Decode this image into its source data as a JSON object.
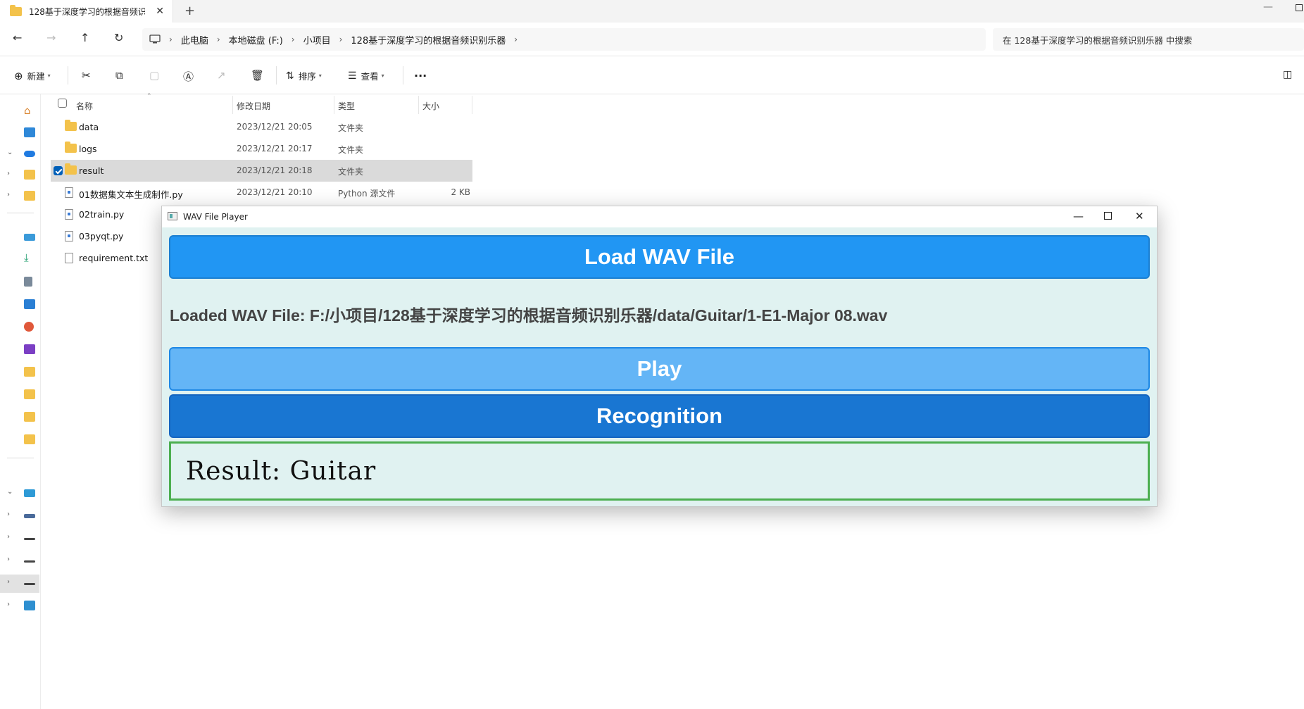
{
  "tab": {
    "title": "128基于深度学习的根据音频识别",
    "close": "✕",
    "new": "+"
  },
  "window": {
    "minimize": "—"
  },
  "address": {
    "crumbs": [
      "此电脑",
      "本地磁盘 (F:)",
      "小项目",
      "128基于深度学习的根据音频识别乐器"
    ],
    "search_placeholder": "在 128基于深度学习的根据音频识别乐器 中搜索"
  },
  "toolbar": {
    "new_label": "新建",
    "sort_label": "排序",
    "view_label": "查看",
    "more": "···"
  },
  "columns": {
    "name": "名称",
    "date": "修改日期",
    "type": "类型",
    "size": "大小"
  },
  "files": [
    {
      "name": "data",
      "date": "2023/12/21 20:05",
      "type": "文件夹",
      "size": "",
      "kind": "folder"
    },
    {
      "name": "logs",
      "date": "2023/12/21 20:17",
      "type": "文件夹",
      "size": "",
      "kind": "folder"
    },
    {
      "name": "result",
      "date": "2023/12/21 20:18",
      "type": "文件夹",
      "size": "",
      "kind": "folder"
    },
    {
      "name": "01数据集文本生成制作.py",
      "date": "2023/12/21 20:10",
      "type": "Python 源文件",
      "size": "2 KB",
      "kind": "py"
    },
    {
      "name": "02train.py",
      "date": "",
      "type": "",
      "size": "",
      "kind": "py"
    },
    {
      "name": "03pyqt.py",
      "date": "",
      "type": "",
      "size": "",
      "kind": "py"
    },
    {
      "name": "requirement.txt",
      "date": "",
      "type": "",
      "size": "",
      "kind": "txt"
    }
  ],
  "player": {
    "title": "WAV File Player",
    "load_button": "Load WAV File",
    "loaded_text": "Loaded WAV File: F:/小项目/128基于深度学习的根据音频识别乐器/data/Guitar/1-E1-Major 08.wav",
    "play_button": "Play",
    "recognition_button": "Recognition",
    "result_text": "Result: Guitar",
    "colors": {
      "load": "#2196f3",
      "play": "#64b5f6",
      "recognition": "#1976d2",
      "result_border": "#4caf50",
      "background": "#e0f2f1"
    }
  }
}
